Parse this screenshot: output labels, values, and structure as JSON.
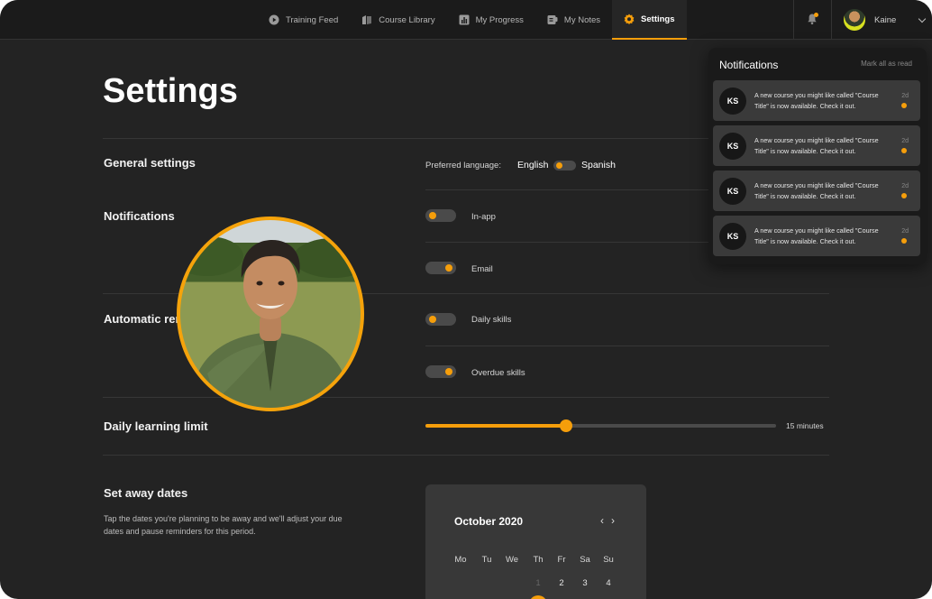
{
  "nav": {
    "items": [
      {
        "label": "Training Feed",
        "icon": "play-circle-icon"
      },
      {
        "label": "Course Library",
        "icon": "books-icon"
      },
      {
        "label": "My Progress",
        "icon": "bar-chart-icon"
      },
      {
        "label": "My Notes",
        "icon": "notes-icon"
      },
      {
        "label": "Settings",
        "icon": "gear-icon",
        "active": true
      }
    ]
  },
  "user": {
    "name": "Kaine"
  },
  "colors": {
    "accent": "#f59e0b",
    "background": "#232323",
    "card": "#383838"
  },
  "page": {
    "title": "Settings"
  },
  "general": {
    "label": "General settings",
    "preferred_language_label": "Preferred language:",
    "lang_left": "English",
    "lang_right": "Spanish"
  },
  "notifications_settings": {
    "label": "Notifications",
    "in_app": "In-app",
    "email": "Email"
  },
  "reminders": {
    "label": "Automatic rem",
    "daily_skills": "Daily skills",
    "overdue_skills": "Overdue skills"
  },
  "learning_limit": {
    "label": "Daily learning limit",
    "value_text": "15 minutes",
    "level": 0.4
  },
  "away": {
    "label": "Set away dates",
    "description_line1": "Tap the dates you're planning to be away and we'll adjust your due",
    "description_line2": "dates and pause reminders for this period."
  },
  "calendar": {
    "month": "October 2020",
    "prev": "‹",
    "next": "›",
    "weekdays": [
      "Mo",
      "Tu",
      "We",
      "Th",
      "Fr",
      "Sa",
      "Su"
    ],
    "first_row": [
      "1",
      "2",
      "3",
      "4"
    ]
  },
  "notifications_panel": {
    "title": "Notifications",
    "mark_all": "Mark all as read",
    "items": [
      {
        "initials": "KS",
        "line1": "A new course you might like called \"Course",
        "line2": "Title\" is now available. Check it out.",
        "time": "2d"
      },
      {
        "initials": "KS",
        "line1": "A new course you might like called \"Course",
        "line2": "Title\" is now available. Check it out.",
        "time": "2d"
      },
      {
        "initials": "KS",
        "line1": "A new course you might like called \"Course",
        "line2": "Title\" is now available. Check it out.",
        "time": "2d"
      },
      {
        "initials": "KS",
        "line1": "A new course you might like called \"Course",
        "line2": "Title\" is now available. Check it out.",
        "time": "2d"
      }
    ]
  }
}
